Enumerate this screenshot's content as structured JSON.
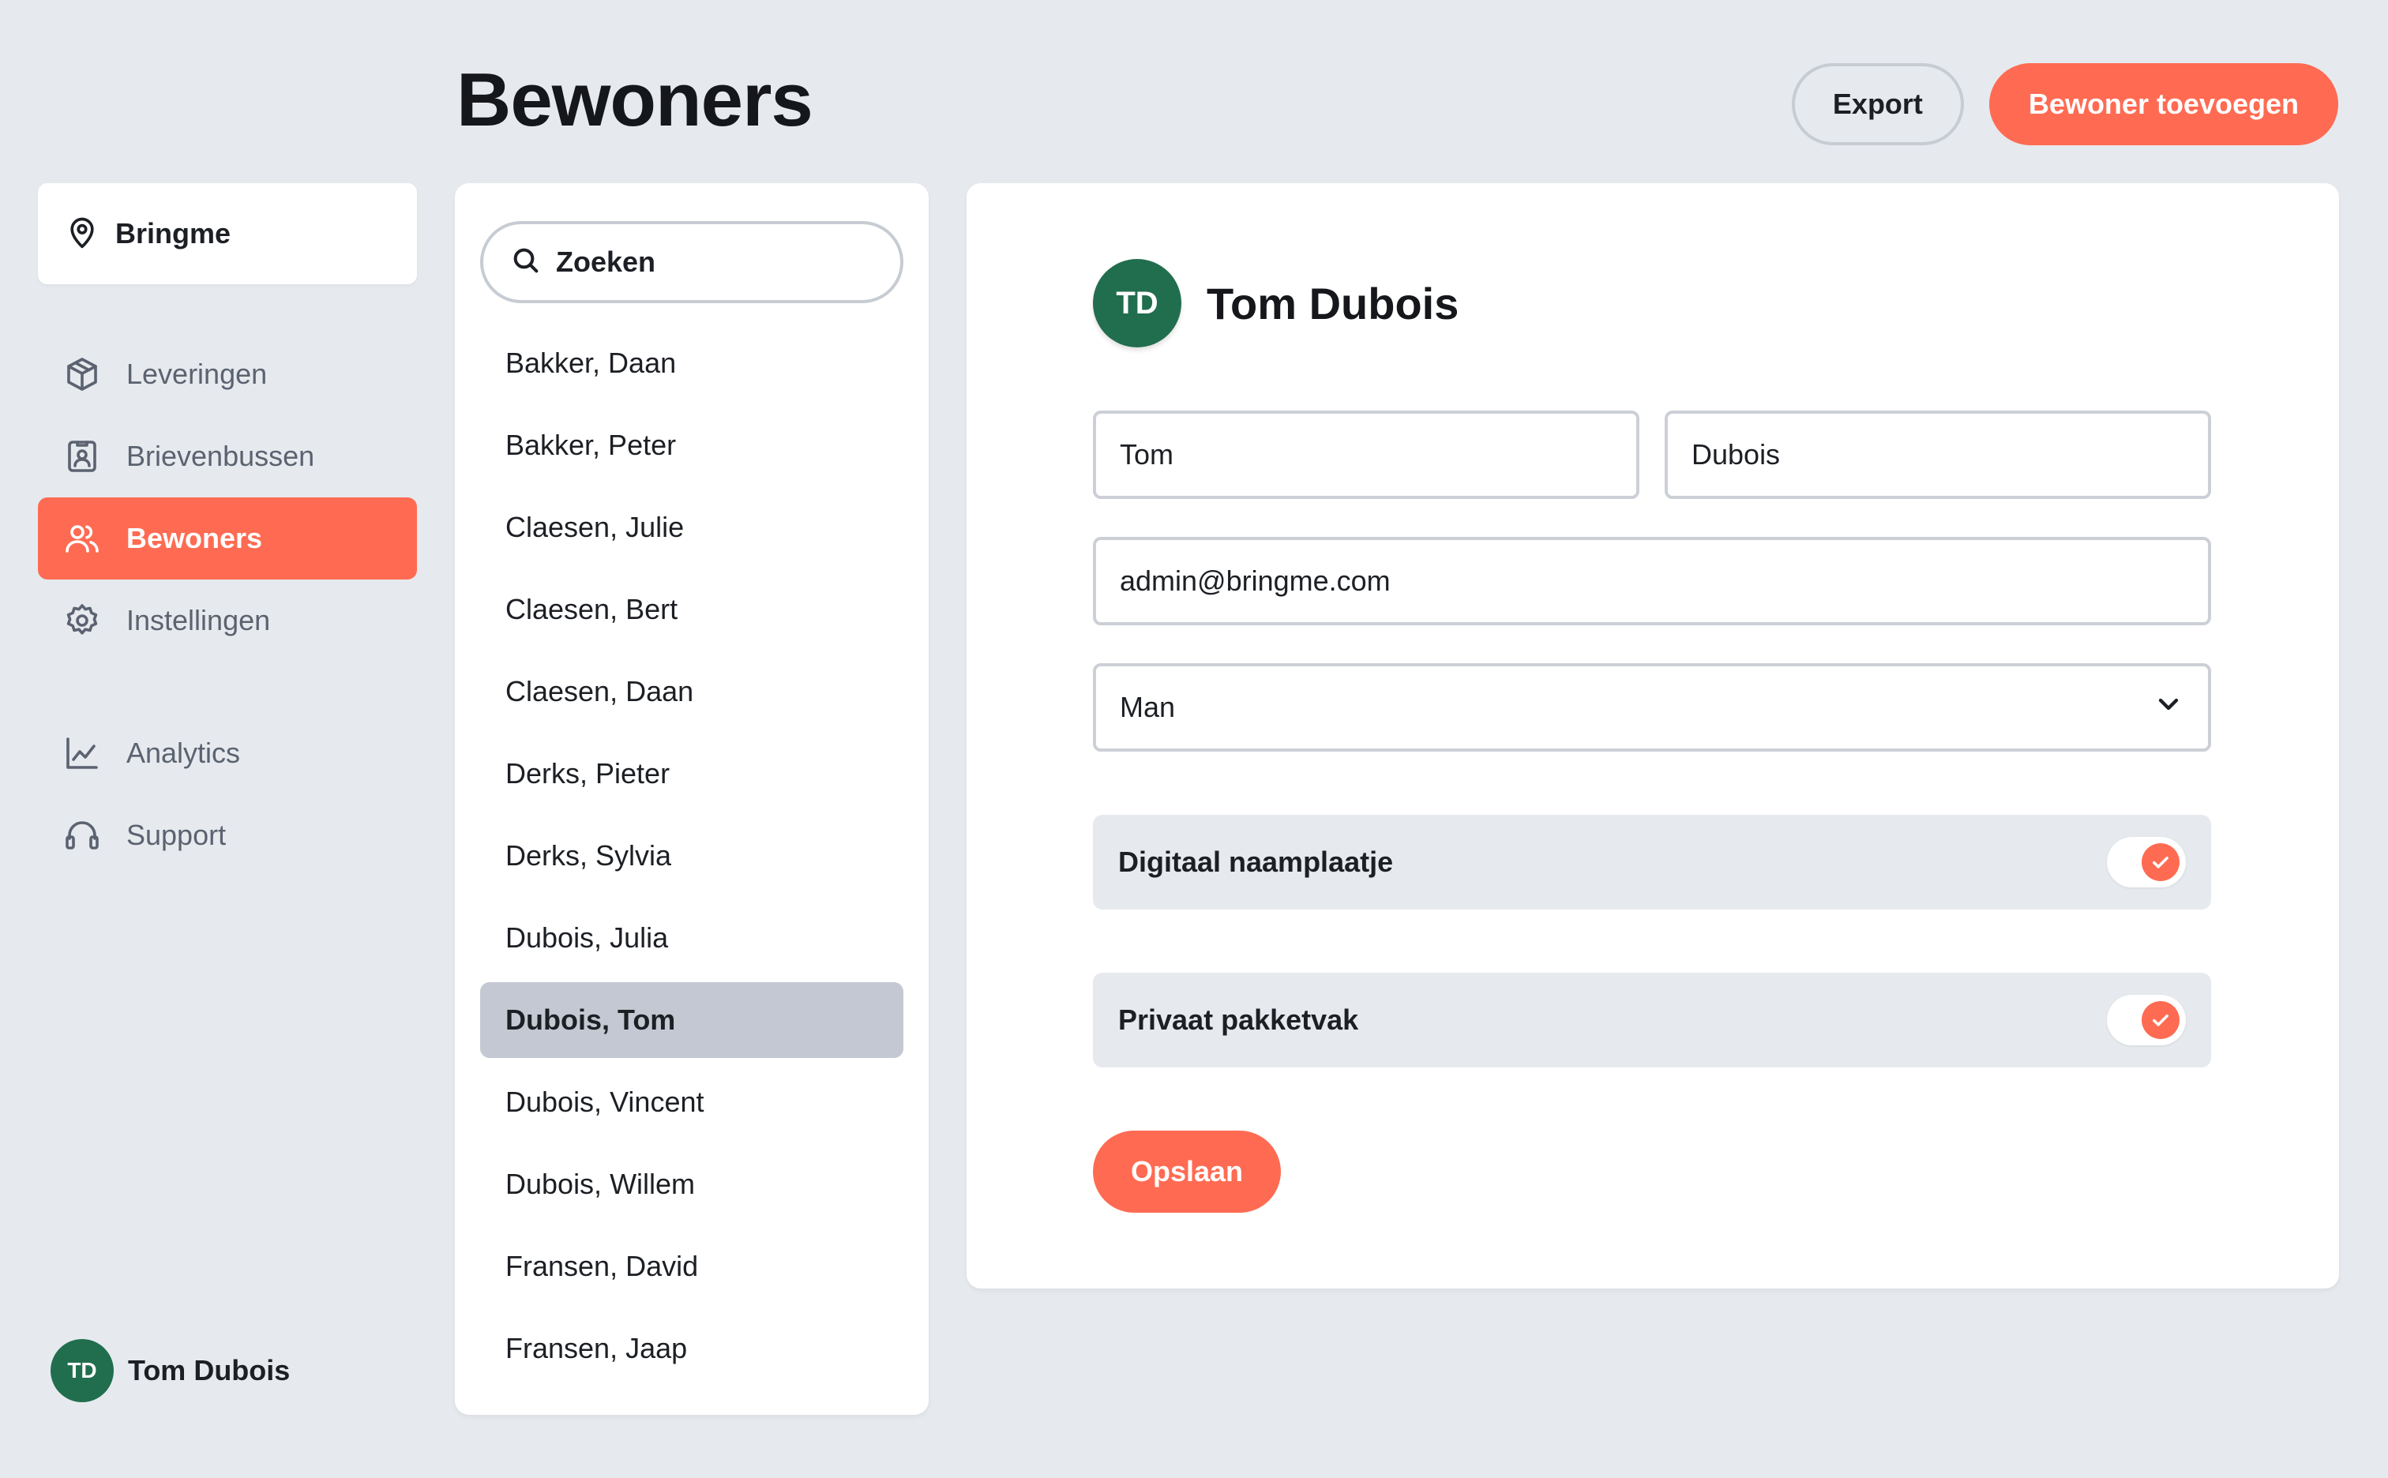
{
  "header": {
    "title": "Bewoners",
    "export_label": "Export",
    "add_label": "Bewoner toevoegen"
  },
  "sidebar": {
    "org_name": "Bringme",
    "org_icon": "location-pin-icon",
    "items": [
      {
        "label": "Leveringen",
        "icon": "package-icon",
        "active": false
      },
      {
        "label": "Brievenbussen",
        "icon": "mailbox-icon",
        "active": false
      },
      {
        "label": "Bewoners",
        "icon": "users-icon",
        "active": true
      },
      {
        "label": "Instellingen",
        "icon": "gear-icon",
        "active": false
      },
      {
        "label": "Analytics",
        "icon": "chart-icon",
        "active": false
      },
      {
        "label": "Support",
        "icon": "headset-icon",
        "active": false
      }
    ],
    "user": {
      "initials": "TD",
      "name": "Tom Dubois"
    }
  },
  "list": {
    "search_placeholder": "Zoeken",
    "residents": [
      "Bakker, Daan",
      "Bakker, Peter",
      "Claesen, Julie",
      "Claesen, Bert",
      "Claesen, Daan",
      "Derks, Pieter",
      "Derks, Sylvia",
      "Dubois, Julia",
      "Dubois, Tom",
      "Dubois, Vincent",
      "Dubois, Willem",
      "Fransen, David",
      "Fransen, Jaap"
    ],
    "selected": "Dubois, Tom"
  },
  "detail": {
    "initials": "TD",
    "name": "Tom Dubois",
    "first_name": "Tom",
    "last_name": "Dubois",
    "email": "admin@bringme.com",
    "gender": "Man",
    "toggles": [
      {
        "label": "Digitaal naamplaatje",
        "checked": true
      },
      {
        "label": "Privaat pakketvak",
        "checked": true
      }
    ],
    "save_label": "Opslaan"
  },
  "colors": {
    "accent": "#ff6b52",
    "avatar": "#216e4e",
    "background": "#e6eaee",
    "selected_row": "#c4c8d2"
  }
}
